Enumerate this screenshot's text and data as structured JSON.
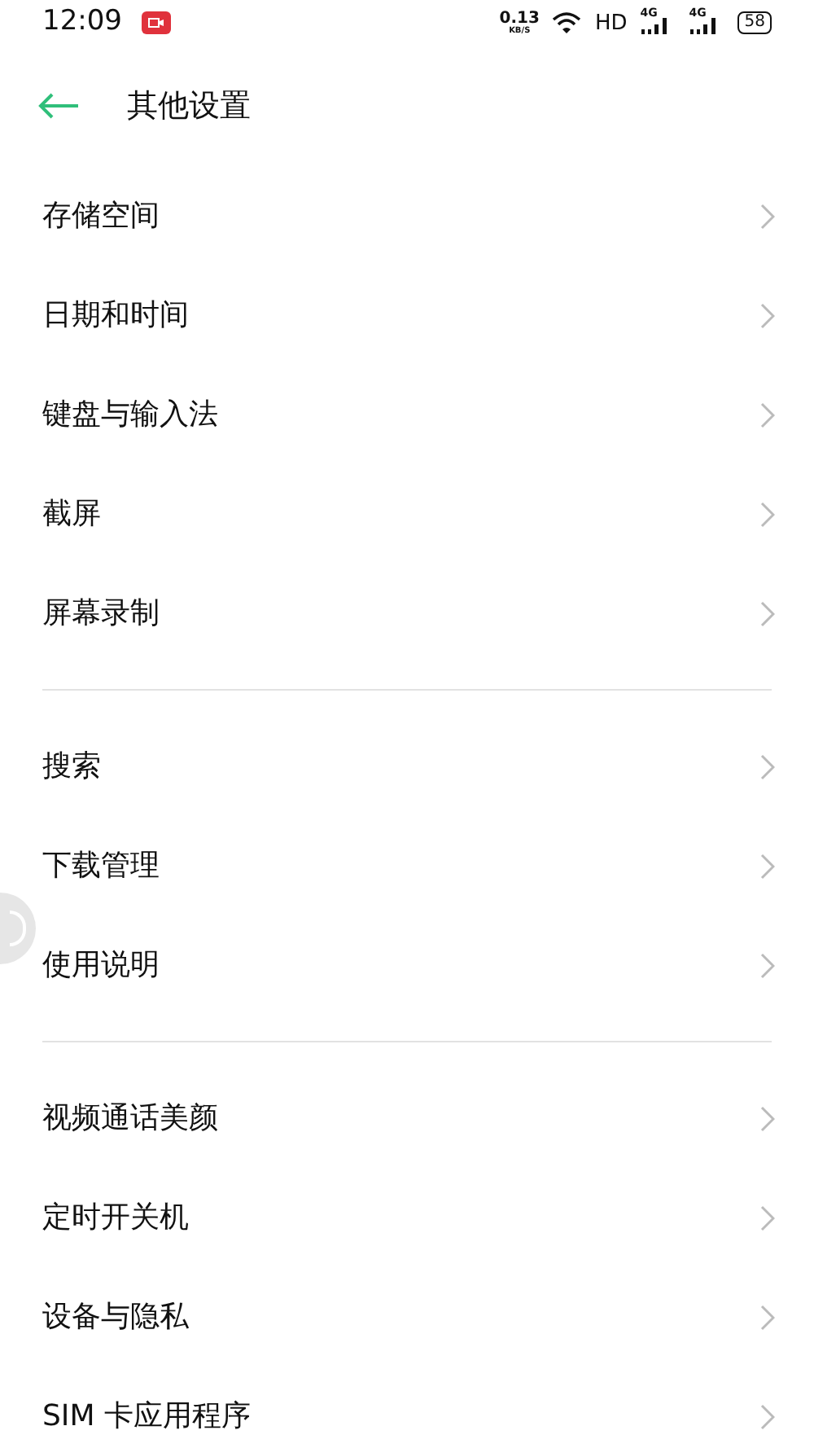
{
  "status_bar": {
    "time": "12:09",
    "speed": "0.13",
    "speed_unit": "KB/S",
    "hd": "HD",
    "networks": [
      "4G",
      "4G"
    ],
    "battery": "58"
  },
  "header": {
    "title": "其他设置"
  },
  "groups": [
    {
      "items": [
        {
          "label": "存储空间"
        },
        {
          "label": "日期和时间"
        },
        {
          "label": "键盘与输入法"
        },
        {
          "label": "截屏"
        },
        {
          "label": "屏幕录制"
        }
      ]
    },
    {
      "items": [
        {
          "label": "搜索"
        },
        {
          "label": "下载管理"
        },
        {
          "label": "使用说明"
        }
      ]
    },
    {
      "items": [
        {
          "label": "视频通话美颜"
        },
        {
          "label": "定时开关机"
        },
        {
          "label": "设备与隐私"
        },
        {
          "label": "SIM 卡应用程序"
        }
      ]
    }
  ]
}
